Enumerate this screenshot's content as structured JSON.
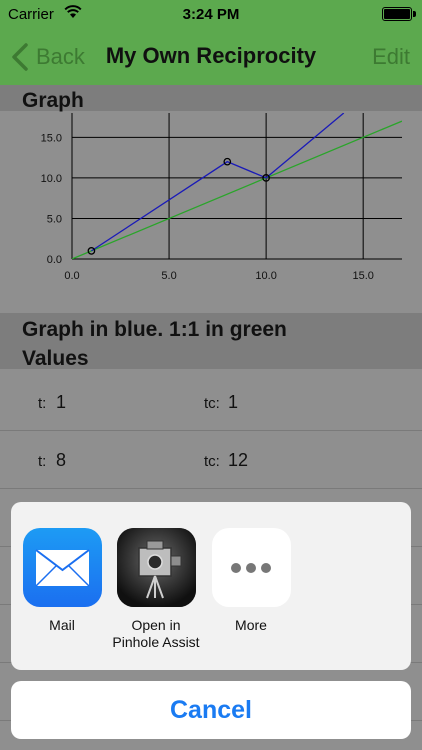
{
  "status_bar": {
    "carrier": "Carrier",
    "time": "3:24 PM"
  },
  "nav": {
    "back_label": "Back",
    "title": "My Own Reciprocity",
    "edit_label": "Edit"
  },
  "sections": {
    "graph_header": "Graph",
    "graph_caption": "Graph in blue. 1:1 in green",
    "values_header": "Values"
  },
  "values": [
    {
      "t_label": "t:",
      "t_value": "1",
      "tc_label": "tc:",
      "tc_value": "1"
    },
    {
      "t_label": "t:",
      "t_value": "8",
      "tc_label": "tc:",
      "tc_value": "12"
    }
  ],
  "chart_data": {
    "type": "line",
    "title": "",
    "xlabel": "",
    "ylabel": "",
    "xlim": [
      0,
      17
    ],
    "ylim": [
      0,
      18
    ],
    "x_ticks": [
      "0.0",
      "5.0",
      "10.0",
      "15.0"
    ],
    "y_ticks": [
      "0.0",
      "5.0",
      "10.0",
      "15.0"
    ],
    "grid": true,
    "series": [
      {
        "color": "#1a1ab8",
        "x": [
          1,
          8,
          10,
          14
        ],
        "y": [
          1,
          12,
          10,
          18
        ],
        "markers": [
          [
            1,
            1
          ],
          [
            8,
            12
          ],
          [
            10,
            10
          ]
        ]
      },
      {
        "color": "#2aa52a",
        "x": [
          0,
          17
        ],
        "y": [
          0,
          17
        ]
      }
    ]
  },
  "share_sheet": {
    "apps": [
      {
        "label": "Mail",
        "icon": "mail-icon"
      },
      {
        "label": "Open in\nPinhole Assist",
        "icon": "pinhole-camera-icon"
      },
      {
        "label": "More",
        "icon": "more-dots-icon"
      }
    ],
    "cancel_label": "Cancel"
  }
}
